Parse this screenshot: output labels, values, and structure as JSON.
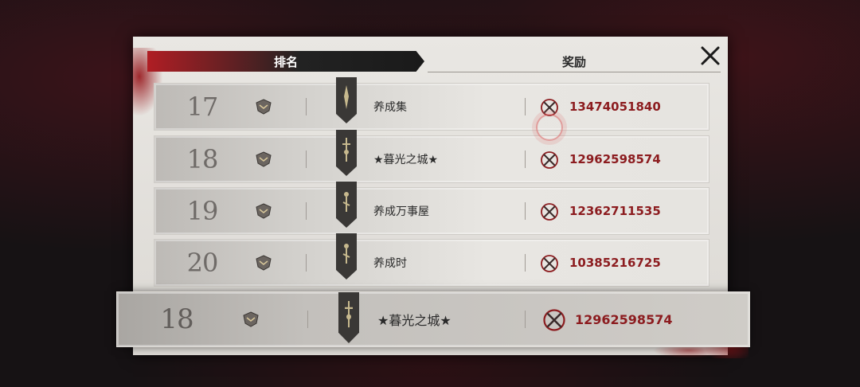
{
  "tabs": {
    "ranking": "排名",
    "rewards": "奖励"
  },
  "rows": [
    {
      "rank": "17",
      "name": "养成集",
      "score": "13474051840"
    },
    {
      "rank": "18",
      "name": "★暮光之城★",
      "score": "12962598574"
    },
    {
      "rank": "19",
      "name": "养成万事屋",
      "score": "12362711535"
    },
    {
      "rank": "20",
      "name": "养成时",
      "score": "10385216725"
    }
  ],
  "my_rank": {
    "rank": "18",
    "name": "★暮光之城★",
    "score": "12962598574"
  },
  "colors": {
    "accent_red": "#b01e24",
    "score_red": "#8c1c1f",
    "panel": "#e9e7e3"
  },
  "icons": {
    "close": "close-x-icon",
    "emblem": "guild-emblem-icon",
    "banner": "guild-banner-icon",
    "reward": "crossed-swords-icon"
  }
}
